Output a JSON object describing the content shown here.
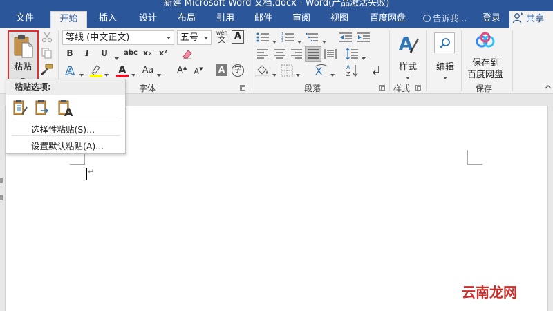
{
  "window": {
    "title": "新建 Microsoft Word 文档.docx - Word(产品激活失败)"
  },
  "tabs": [
    {
      "label": "文件"
    },
    {
      "label": "开始"
    },
    {
      "label": "插入"
    },
    {
      "label": "设计"
    },
    {
      "label": "布局"
    },
    {
      "label": "引用"
    },
    {
      "label": "邮件"
    },
    {
      "label": "审阅"
    },
    {
      "label": "视图"
    },
    {
      "label": "百度网盘"
    }
  ],
  "active_tab": "开始",
  "tell_me": "告诉我...",
  "login": "登录",
  "share": "共享",
  "ribbon": {
    "clipboard": {
      "paste_label": "粘贴"
    },
    "font": {
      "font_name": "等线 (中文正文)",
      "font_size": "五号",
      "group_label": "字体",
      "bold": "B",
      "italic": "I",
      "underline": "U",
      "strikethrough": "abc",
      "subscript": "x₂",
      "superscript": "x²",
      "grow": "A",
      "shrink": "A",
      "change_case": "Aa",
      "phonetic": "wén",
      "phonetic_char": "文",
      "enclosed": "字"
    },
    "paragraph": {
      "group_label": "段落"
    },
    "styles": {
      "button_label": "样式",
      "group_label": "样式"
    },
    "editing": {
      "button_label": "编辑"
    },
    "save": {
      "button_line1": "保存到",
      "button_line2": "百度网盘",
      "group_label": "保存"
    }
  },
  "paste_menu": {
    "header": "粘贴选项:",
    "items": [
      {
        "label": "选择性粘贴(S)..."
      },
      {
        "label": "设置默认粘贴(A)..."
      }
    ]
  },
  "watermark": "云南龙网",
  "colors": {
    "accent": "#2b579a",
    "highlight": "#ffff00",
    "font_color": "#e81123",
    "watermark": "#c9302c"
  }
}
